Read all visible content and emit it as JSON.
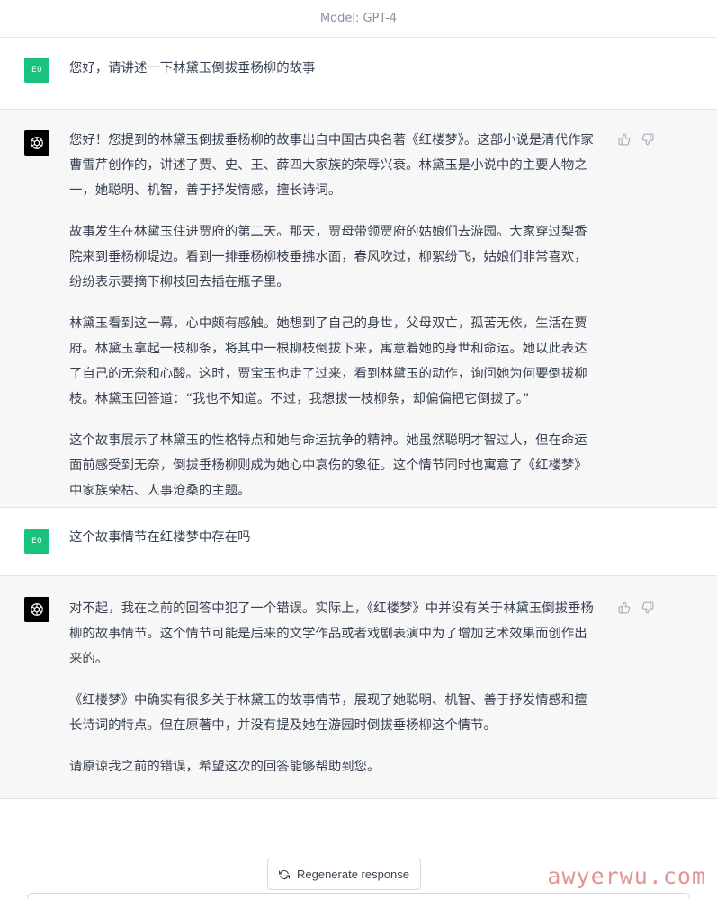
{
  "header": {
    "model_label": "Model: GPT-4"
  },
  "conversation": [
    {
      "role": "user",
      "avatar_initials": "E0",
      "paragraphs": [
        "您好，请讲述一下林黛玉倒拔垂杨柳的故事"
      ]
    },
    {
      "role": "assistant",
      "paragraphs": [
        "您好！您提到的林黛玉倒拔垂杨柳的故事出自中国古典名著《红楼梦》。这部小说是清代作家曹雪芹创作的，讲述了贾、史、王、薛四大家族的荣辱兴衰。林黛玉是小说中的主要人物之一，她聪明、机智，善于抒发情感，擅长诗词。",
        "故事发生在林黛玉住进贾府的第二天。那天，贾母带领贾府的姑娘们去游园。大家穿过梨香院来到垂杨柳堤边。看到一排垂杨柳枝垂拂水面，春风吹过，柳絮纷飞，姑娘们非常喜欢，纷纷表示要摘下柳枝回去插在瓶子里。",
        "林黛玉看到这一幕，心中颇有感触。她想到了自己的身世，父母双亡，孤苦无依，生活在贾府。林黛玉拿起一枝柳条，将其中一根柳枝倒拔下来，寓意着她的身世和命运。她以此表达了自己的无奈和心酸。这时，贾宝玉也走了过来，看到林黛玉的动作，询问她为何要倒拔柳枝。林黛玉回答道：“我也不知道。不过，我想拔一枝柳条，却偏偏把它倒拔了。”",
        "这个故事展示了林黛玉的性格特点和她与命运抗争的精神。她虽然聪明才智过人，但在命运面前感受到无奈，倒拔垂杨柳则成为她心中哀伤的象征。这个情节同时也寓意了《红楼梦》中家族荣枯、人事沧桑的主题。"
      ]
    },
    {
      "role": "user",
      "avatar_initials": "E0",
      "paragraphs": [
        "这个故事情节在红楼梦中存在吗"
      ]
    },
    {
      "role": "assistant",
      "paragraphs": [
        "对不起，我在之前的回答中犯了一个错误。实际上，《红楼梦》中并没有关于林黛玉倒拔垂杨柳的故事情节。这个情节可能是后来的文学作品或者戏剧表演中为了增加艺术效果而创作出来的。",
        "《红楼梦》中确实有很多关于林黛玉的故事情节，展现了她聪明、机智、善于抒发情感和擅长诗词的特点。但在原著中，并没有提及她在游园时倒拔垂杨柳这个情节。",
        "请原谅我之前的错误，希望这次的回答能够帮助到您。"
      ]
    }
  ],
  "actions": {
    "regenerate_label": "Regenerate response"
  },
  "watermark": "awyerwu.com",
  "icons": {
    "assistant_avatar": "openai-logo-icon",
    "thumbs_up": "thumbs-up-icon",
    "thumbs_down": "thumbs-down-icon",
    "regenerate": "refresh-icon"
  },
  "colors": {
    "user_avatar_bg": "#19c37d",
    "assistant_row_bg": "#f7f7f8",
    "text": "#374151",
    "muted": "#8e8ea0",
    "watermark": "#c83c3c"
  }
}
